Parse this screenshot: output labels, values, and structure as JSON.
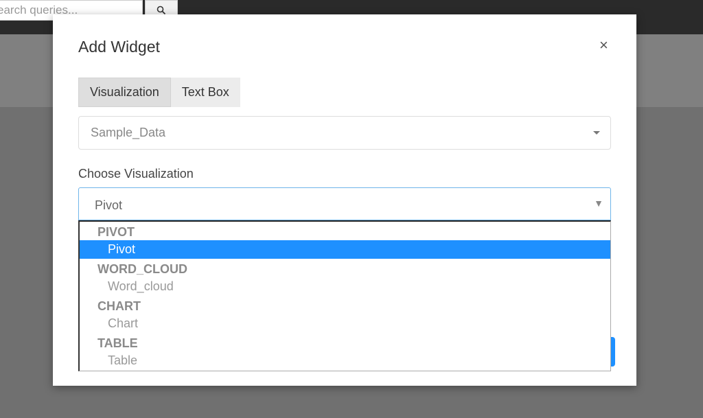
{
  "background": {
    "search": {
      "placeholder": "earch queries..."
    },
    "search_icon": "magnifier-icon"
  },
  "modal": {
    "title": "Add Widget",
    "close_label": "×",
    "tabs": [
      {
        "label": "Visualization",
        "active": true
      },
      {
        "label": "Text Box",
        "active": false
      }
    ],
    "data_source": {
      "value": "Sample_Data"
    },
    "choose_label": "Choose Visualization",
    "viz_select": {
      "value": "Pivot",
      "arrow": "▼"
    },
    "options": [
      {
        "group": "PIVOT",
        "item": "Pivot"
      },
      {
        "group": "WORD_CLOUD",
        "item": "Word_cloud"
      },
      {
        "group": "CHART",
        "item": "Chart"
      },
      {
        "group": "TABLE",
        "item": "Table"
      }
    ],
    "selected_option": "Pivot",
    "accent_color": "#1e90ff"
  }
}
